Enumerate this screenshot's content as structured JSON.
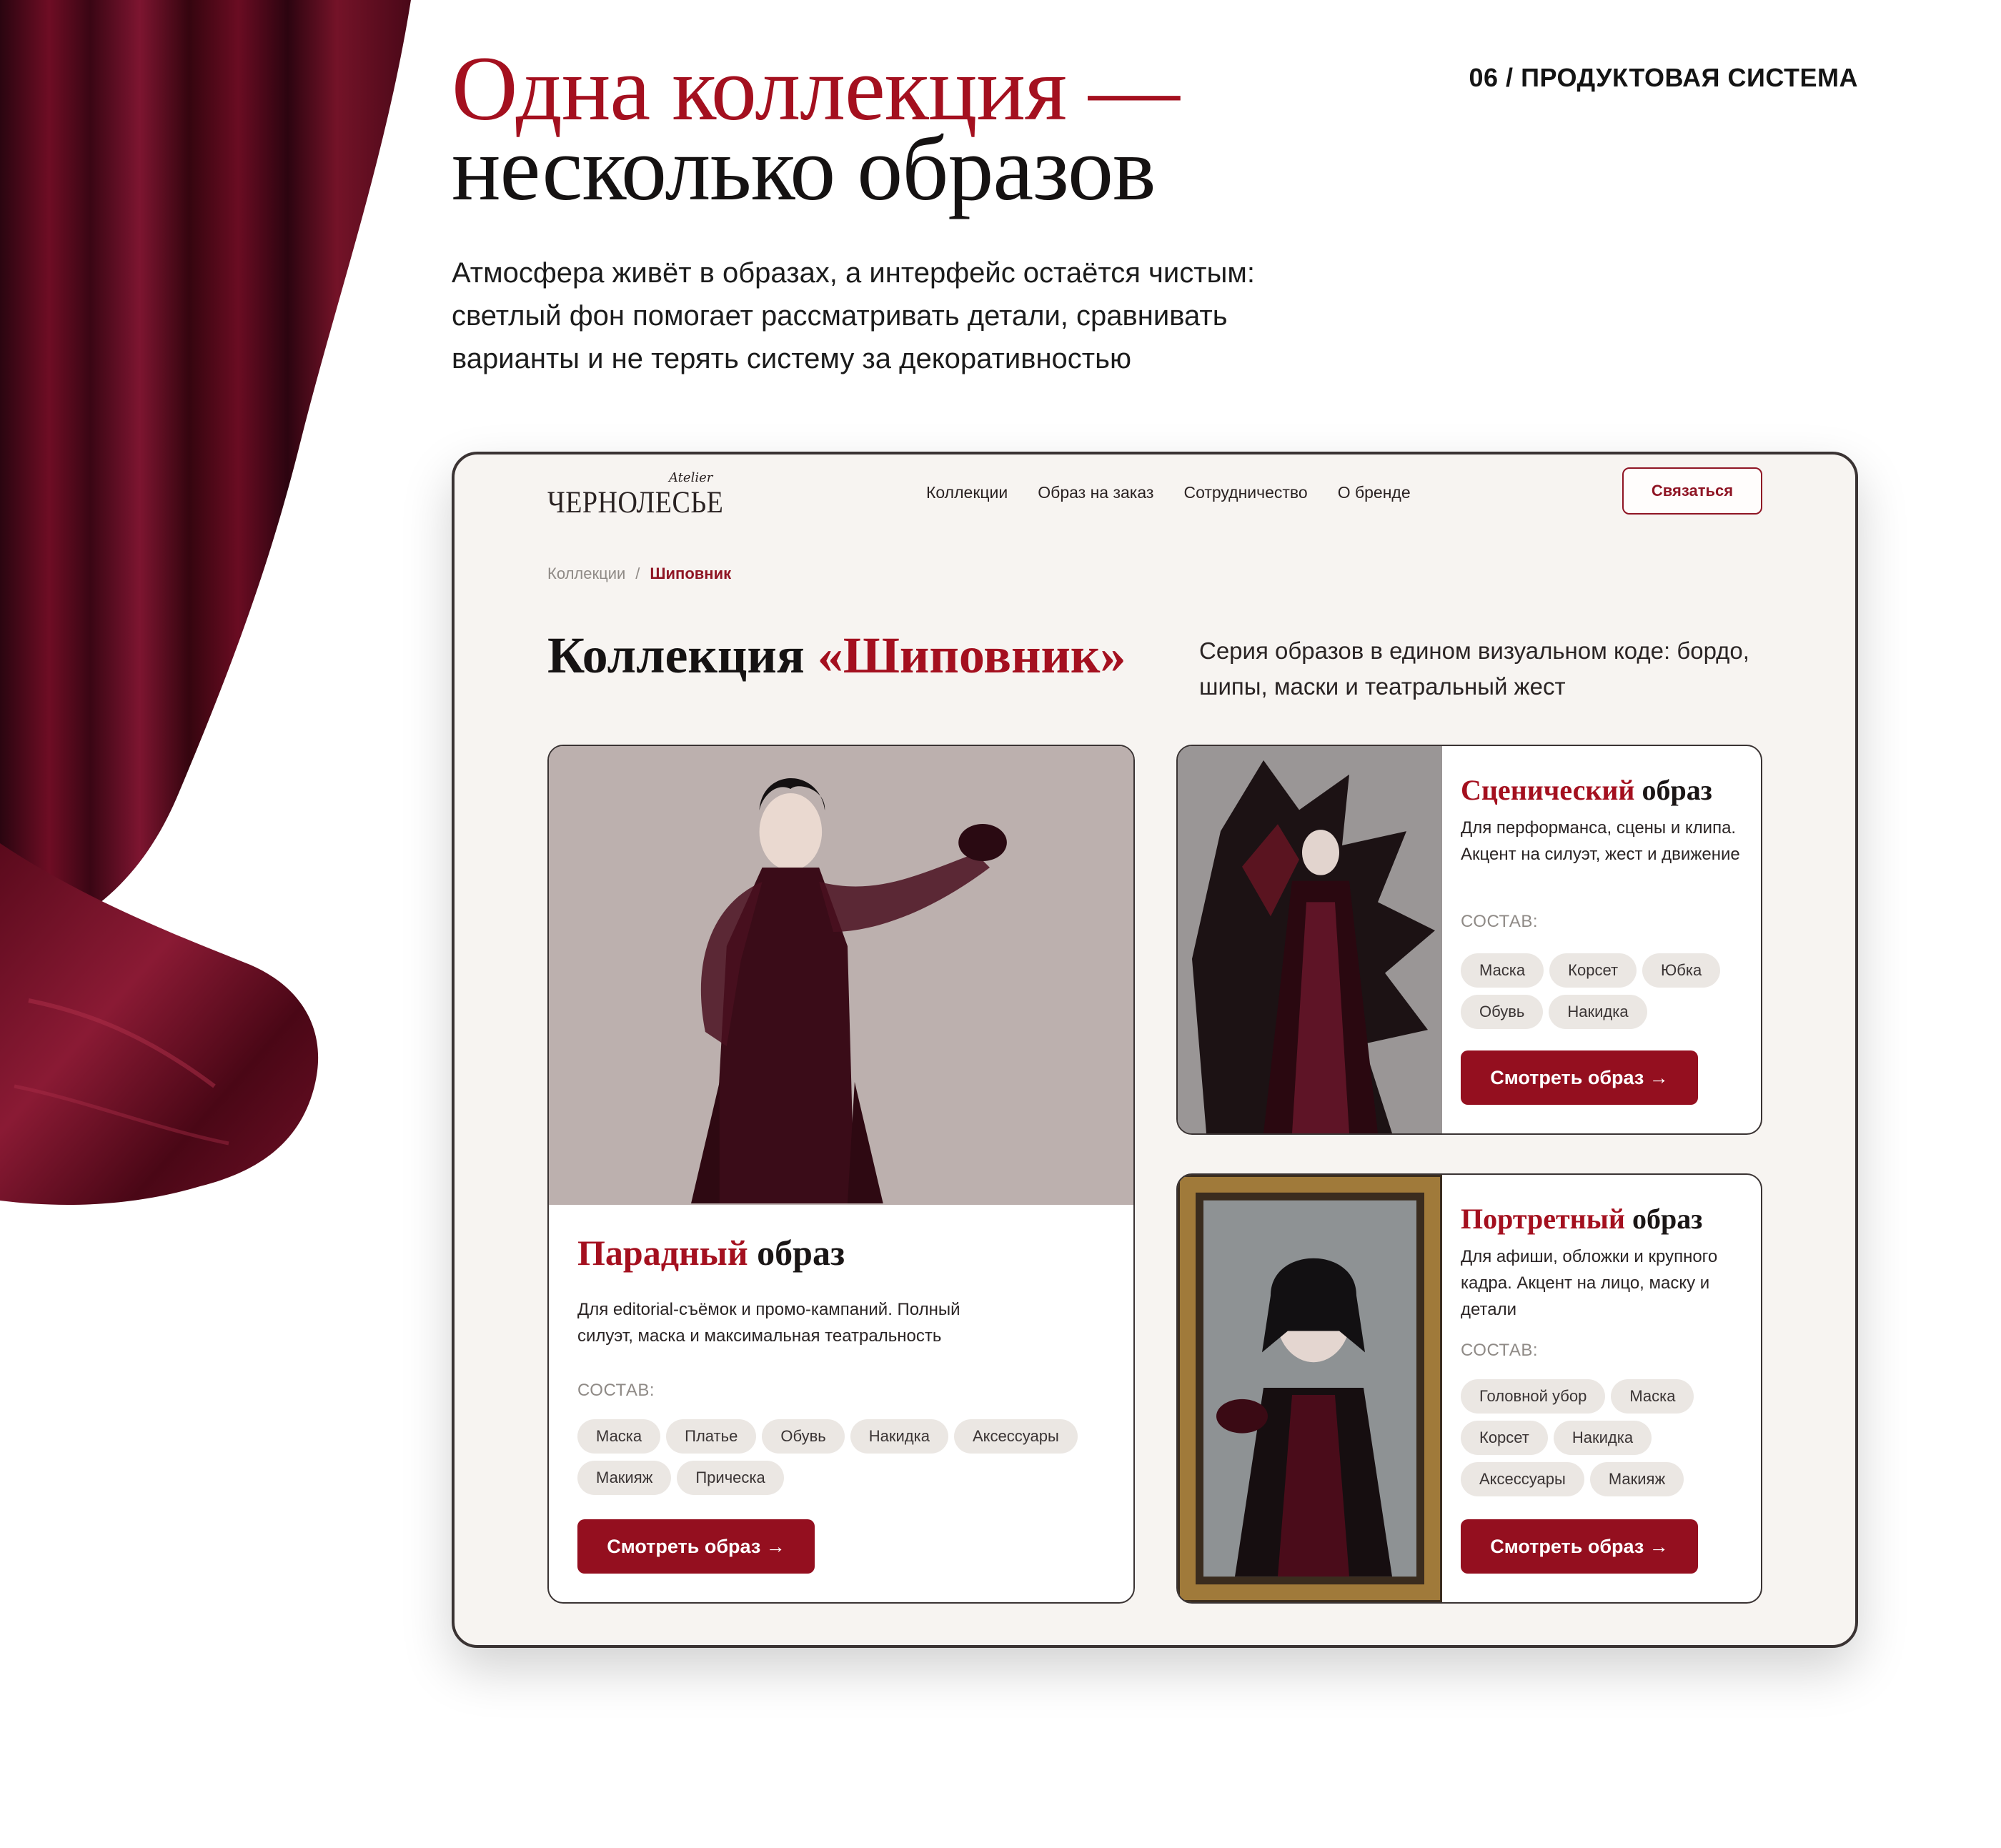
{
  "slide": {
    "label": "06 / ПРОДУКТОВАЯ СИСТЕМА",
    "headline_line1": "Одна коллекция —",
    "headline_line2": "несколько образов",
    "lead": "Атмосфера живёт в образах, а интерфейс остаётся чистым: светлый фон помогает рассматривать детали, сравнивать варианты и не терять систему за декоративностью"
  },
  "site": {
    "logo": {
      "script": "Atelier",
      "brand": "ЧЕРНОЛЕСЬЕ"
    },
    "nav": [
      "Коллекции",
      "Образ на заказ",
      "Сотрудничество",
      "О бренде"
    ],
    "contact_button": "Связаться",
    "breadcrumb": {
      "root": "Коллекции",
      "separator": "/",
      "current": "Шиповник"
    },
    "collection": {
      "title_prefix": "Коллекция ",
      "title_accent": "«Шиповник»",
      "description": "Серия образов в едином визуальном коде: бордо, шипы, маски и театральный жест"
    },
    "composition_label": "СОСТАВ:",
    "view_button": "Смотреть образ →",
    "looks": [
      {
        "title_accent": "Парадный",
        "title_rest": " образ",
        "description": "Для editorial-съёмок и промо-кампаний. Полный силуэт, маска и максимальная театральность",
        "chips": [
          "Маска",
          "Платье",
          "Обувь",
          "Накидка",
          "Аксессуары",
          "Макияж",
          "Прическа"
        ]
      },
      {
        "title_accent": "Сценический",
        "title_rest": " образ",
        "description": "Для перформанса, сцены и клипа. Акцент на силуэт, жест и движение",
        "chips": [
          "Маска",
          "Корсет",
          "Юбка",
          "Обувь",
          "Накидка"
        ]
      },
      {
        "title_accent": "Портретный",
        "title_rest": " образ",
        "description": "Для афиши, обложки и крупного кадра. Акцент на лицо, маску и детали",
        "chips": [
          "Головной убор",
          "Маска",
          "Корсет",
          "Накидка",
          "Аксессуары",
          "Макияж"
        ]
      }
    ]
  },
  "colors": {
    "accent": "#a4101f",
    "button": "#940f1f",
    "page_bg": "#f7f4f1",
    "chip_bg": "#ebe7e3",
    "curtain": "#5c0a1e"
  }
}
